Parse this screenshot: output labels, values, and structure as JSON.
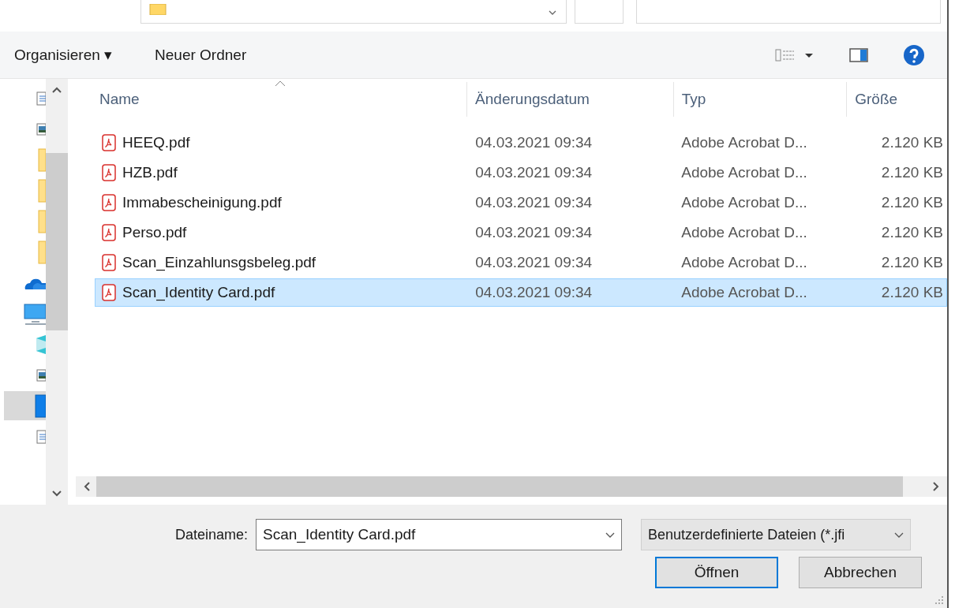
{
  "toolbar": {
    "organize": "Organisieren ▾",
    "new_folder": "Neuer Ordner"
  },
  "nav": [
    {
      "kind": "document",
      "selected": false
    },
    {
      "kind": "picture",
      "selected": false
    },
    {
      "kind": "folder",
      "selected": false
    },
    {
      "kind": "folder",
      "selected": false
    },
    {
      "kind": "folder",
      "selected": false
    },
    {
      "kind": "folder",
      "selected": false
    },
    {
      "kind": "cloud",
      "selected": false
    },
    {
      "kind": "monitor",
      "selected": false
    },
    {
      "kind": "cube",
      "selected": false
    },
    {
      "kind": "picture",
      "selected": false
    },
    {
      "kind": "desktop",
      "selected": true
    },
    {
      "kind": "document",
      "selected": false
    }
  ],
  "table": {
    "columns": [
      "Name",
      "Änderungsdatum",
      "Typ",
      "Größe"
    ],
    "rows": [
      {
        "name": "HEEQ.pdf",
        "date": "04.03.2021 09:34",
        "type": "Adobe Acrobat D...",
        "size": "2.120 KB",
        "selected": false
      },
      {
        "name": "HZB.pdf",
        "date": "04.03.2021 09:34",
        "type": "Adobe Acrobat D...",
        "size": "2.120 KB",
        "selected": false
      },
      {
        "name": "Immabescheinigung.pdf",
        "date": "04.03.2021 09:34",
        "type": "Adobe Acrobat D...",
        "size": "2.120 KB",
        "selected": false
      },
      {
        "name": "Perso.pdf",
        "date": "04.03.2021 09:34",
        "type": "Adobe Acrobat D...",
        "size": "2.120 KB",
        "selected": false
      },
      {
        "name": "Scan_Einzahlunsgsbeleg.pdf",
        "date": "04.03.2021 09:34",
        "type": "Adobe Acrobat D...",
        "size": "2.120 KB",
        "selected": false
      },
      {
        "name": "Scan_Identity Card.pdf",
        "date": "04.03.2021 09:34",
        "type": "Adobe Acrobat D...",
        "size": "2.120 KB",
        "selected": true
      }
    ]
  },
  "footer": {
    "filename_label": "Dateiname:",
    "filename": "Scan_Identity Card.pdf",
    "filter": "Benutzerdefinierte Dateien (*.jfi",
    "open": "Öffnen",
    "cancel": "Abbrechen"
  }
}
